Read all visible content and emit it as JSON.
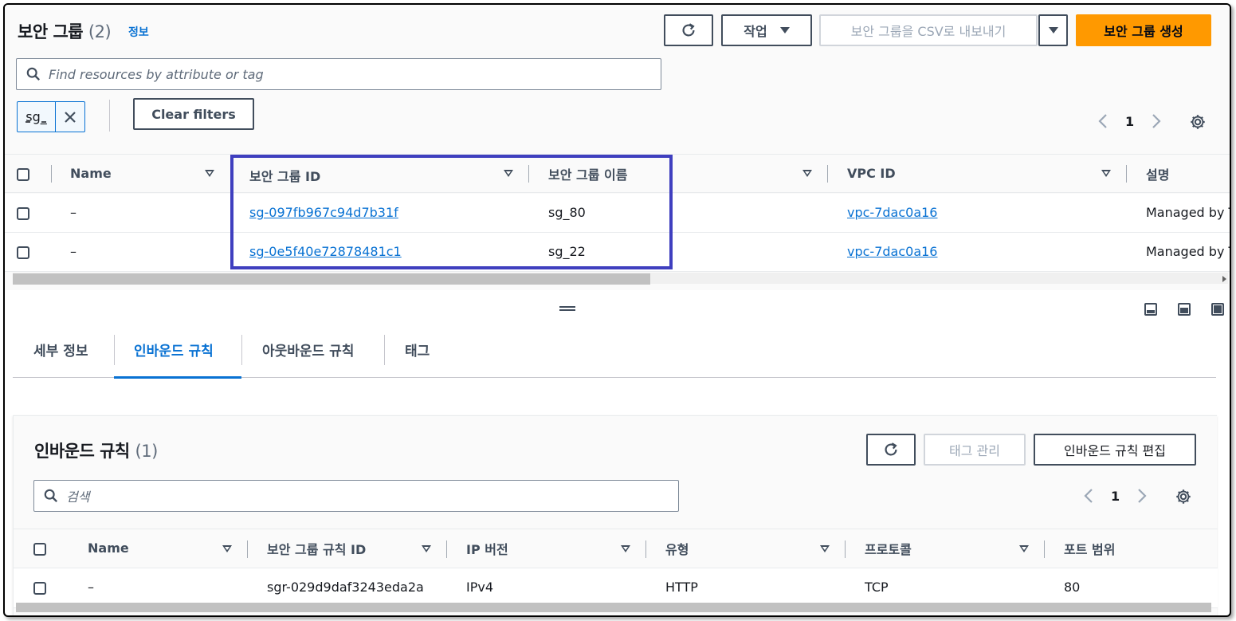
{
  "header": {
    "title": "보안 그룹",
    "count": "(2)",
    "info_link": "정보",
    "actions_label": "작업",
    "export_label": "보안 그룹을 CSV로 내보내기",
    "create_label": "보안 그룹 생성"
  },
  "search": {
    "placeholder": "Find resources by attribute or tag"
  },
  "filter": {
    "token": "sg_",
    "clear_label": "Clear filters"
  },
  "pagination": {
    "page": "1"
  },
  "table": {
    "columns": [
      "Name",
      "보안 그룹 ID",
      "보안 그룹 이름",
      "VPC ID",
      "설명"
    ],
    "rows": [
      {
        "name": "–",
        "id": "sg-097fb967c94d7b31f",
        "group_name": "sg_80",
        "vpc": "vpc-7dac0a16",
        "desc": "Managed by T"
      },
      {
        "name": "–",
        "id": "sg-0e5f40e72878481c1",
        "group_name": "sg_22",
        "vpc": "vpc-7dac0a16",
        "desc": "Managed by T"
      }
    ]
  },
  "tabs": [
    {
      "label": "세부 정보",
      "active": false
    },
    {
      "label": "인바운드 규칙",
      "active": true
    },
    {
      "label": "아웃바운드 규칙",
      "active": false
    },
    {
      "label": "태그",
      "active": false
    }
  ],
  "inbound": {
    "title": "인바운드 규칙",
    "count": "(1)",
    "manage_tags_label": "태그 관리",
    "edit_label": "인바운드 규칙 편집",
    "search_placeholder": "검색",
    "page": "1",
    "columns": [
      "Name",
      "보안 그룹 규칙 ID",
      "IP 버전",
      "유형",
      "프로토콜",
      "포트 범위"
    ],
    "rows": [
      {
        "name": "–",
        "rule_id": "sgr-029d9daf3243eda2a",
        "ip_version": "IPv4",
        "type": "HTTP",
        "protocol": "TCP",
        "port": "80"
      }
    ]
  },
  "colors": {
    "accent": "#0972d3",
    "primary": "#ff9900",
    "highlight": "#3f3fbf"
  }
}
